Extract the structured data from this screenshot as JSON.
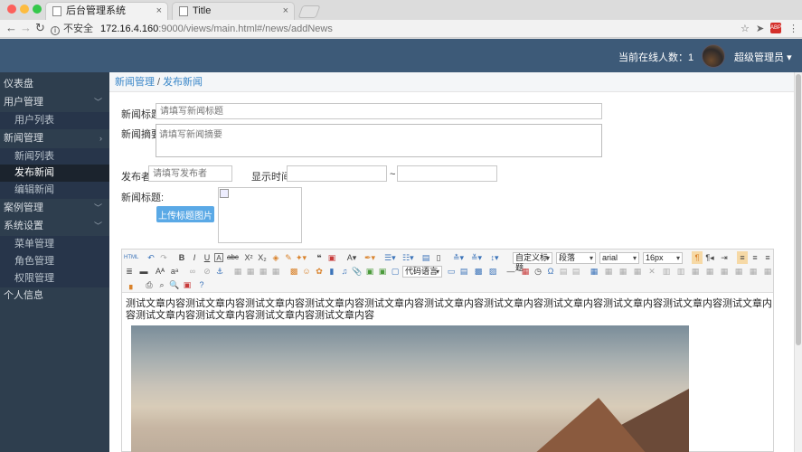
{
  "browser": {
    "tabs": [
      {
        "title": "后台管理系统",
        "close": "×"
      },
      {
        "title": "Title",
        "close": "×"
      }
    ],
    "url": {
      "insecure_label": "不安全",
      "host": "172.16.4.160",
      "path": ":9000/views/main.html#/news/addNews"
    },
    "icons": [
      "back-icon",
      "forward-icon",
      "reload-icon",
      "info-icon",
      "star-icon",
      "send-icon",
      "adblock-icon",
      "menu-icon"
    ],
    "adblock_label": "ABP"
  },
  "header": {
    "online_label": "当前在线人数：1",
    "admin_name": "超级管理员",
    "admin_caret": "▾"
  },
  "sidebar": {
    "items": [
      {
        "label": "仪表盘",
        "level": 1
      },
      {
        "label": "用户管理",
        "level": 1,
        "arrow": "﹀"
      },
      {
        "label": "用户列表",
        "level": 2
      },
      {
        "label": "新闻管理",
        "level": 1,
        "arrow": "›"
      },
      {
        "label": "新闻列表",
        "level": 2
      },
      {
        "label": "发布新闻",
        "level": 2,
        "active": true
      },
      {
        "label": "编辑新闻",
        "level": 2
      },
      {
        "label": "案例管理",
        "level": 1,
        "arrow": "﹀"
      },
      {
        "label": "系统设置",
        "level": 1,
        "arrow": "﹀"
      },
      {
        "label": "菜单管理",
        "level": 2
      },
      {
        "label": "角色管理",
        "level": 2
      },
      {
        "label": "权限管理",
        "level": 2
      },
      {
        "label": "个人信息",
        "level": 1
      }
    ]
  },
  "breadcrumb": {
    "parent": "新闻管理",
    "separator": "/",
    "current": "发布新闻"
  },
  "form": {
    "title_label": "新闻标题:",
    "title_placeholder": "请填写新闻标题",
    "summary_label": "新闻摘要:",
    "summary_placeholder": "请填写新闻摘要",
    "publisher_label": "发布者:",
    "publisher_placeholder": "请填写发布者",
    "display_time_label": "显示时间:",
    "range_separator": "~",
    "image_label": "新闻标题:",
    "upload_button": "上传标题图片"
  },
  "editor": {
    "selects": {
      "heading": "自定义标题",
      "paragraph": "段落",
      "font": "arial",
      "size": "16px",
      "code_lang": "代码语言"
    },
    "html_button": "HTML",
    "content_text": "测试文章内容测试文章内容测试文章内容测试文章内容测试文章内容测试文章内容测试文章内容测试文章内容测试文章内容测试文章内容测试文章内容测试文章内容测试文章内容测试文章内容测试文章内容"
  }
}
